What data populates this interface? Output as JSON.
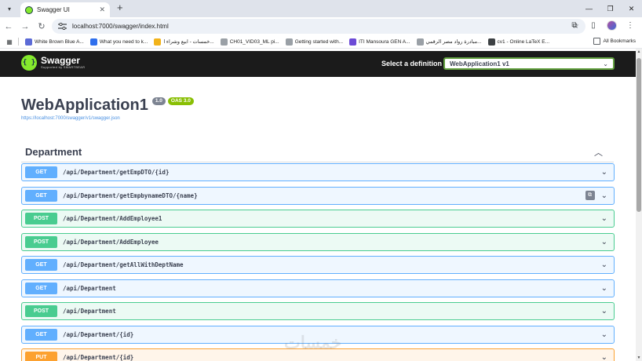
{
  "browser": {
    "tab_title": "Swagger UI",
    "url": "localhost:7000/swagger/index.html",
    "bookmarks": [
      {
        "label": "White Brown Blue A...",
        "color": "#5b6ad6"
      },
      {
        "label": "What you need to k...",
        "color": "#2f6fed"
      },
      {
        "label": "خمسات - ابيع وشراء ا...",
        "color": "#f2b31a"
      },
      {
        "label": "CH01_VID03_ML pi...",
        "color": "#9aa0a6"
      },
      {
        "label": "Getting started with...",
        "color": "#9aa0a6"
      },
      {
        "label": "ITI Mansoura GEN A...",
        "color": "#6c4ad6"
      },
      {
        "label": "مبادرة رواد مصر الرقمي...",
        "color": "#9aa0a6"
      },
      {
        "label": "cv1 - Online LaTeX E...",
        "color": "#3c4043"
      }
    ],
    "all_bookmarks_label": "All Bookmarks"
  },
  "swagger": {
    "logo_name": "Swagger",
    "logo_sub": "Supported by SMARTBEAR",
    "definition_label": "Select a definition",
    "definition_value": "WebApplication1 v1",
    "title": "WebApplication1",
    "version_badge": "1.0",
    "oas_badge": "OAS 3.0",
    "json_link": "https://localhost:7000/swagger/v1/swagger.json",
    "section_title": "Department",
    "operations": [
      {
        "method": "GET",
        "path": "/api/Department/getEmpDTO/{id}"
      },
      {
        "method": "GET",
        "path": "/api/Department/getEmpbynameDTO/{name}"
      },
      {
        "method": "POST",
        "path": "/api/Department/AddEmployee1"
      },
      {
        "method": "POST",
        "path": "/api/Department/AddEmployee"
      },
      {
        "method": "GET",
        "path": "/api/Department/getAllWithDeptName"
      },
      {
        "method": "GET",
        "path": "/api/Department"
      },
      {
        "method": "POST",
        "path": "/api/Department"
      },
      {
        "method": "GET",
        "path": "/api/Department/{id}"
      },
      {
        "method": "PUT",
        "path": "/api/Department/{id}"
      }
    ]
  },
  "watermark": "خمسات"
}
